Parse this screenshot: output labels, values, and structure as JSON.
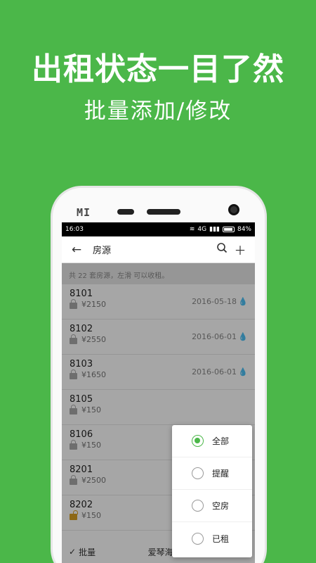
{
  "banner": {
    "headline": "出租状态一目了然",
    "subline": "批量添加/修改"
  },
  "phone": {
    "brand": "MI"
  },
  "status_bar": {
    "time": "16:03",
    "battery": "84%",
    "network": "4G"
  },
  "toolbar": {
    "back_icon": "arrow-left-icon",
    "title": "房源",
    "search_icon": "search-icon",
    "add_icon": "plus-icon"
  },
  "hint": "共 22 套房源，左滑 可以收租。",
  "listings": [
    {
      "room": "8101",
      "price": "¥2150",
      "date": "2016-05-18",
      "locked": true
    },
    {
      "room": "8102",
      "price": "¥2550",
      "date": "2016-06-01",
      "locked": true
    },
    {
      "room": "8103",
      "price": "¥1650",
      "date": "2016-06-01",
      "locked": true
    },
    {
      "room": "8105",
      "price": "¥150",
      "date": "",
      "locked": true
    },
    {
      "room": "8106",
      "price": "¥150",
      "date": "",
      "locked": true
    },
    {
      "room": "8201",
      "price": "¥2500",
      "date": "",
      "locked": true
    },
    {
      "room": "8202",
      "price": "¥150",
      "date": "",
      "locked": false
    }
  ],
  "bottom_bar": {
    "batch_label": "批量",
    "center_label": "爱琴海",
    "filter_label": "全部"
  },
  "filter_menu": {
    "options": [
      {
        "label": "全部",
        "checked": true
      },
      {
        "label": "提醒",
        "checked": false
      },
      {
        "label": "空房",
        "checked": false
      },
      {
        "label": "已租",
        "checked": false
      }
    ]
  },
  "colors": {
    "brand_green": "#4bb749",
    "lock_open": "#d9a021"
  }
}
